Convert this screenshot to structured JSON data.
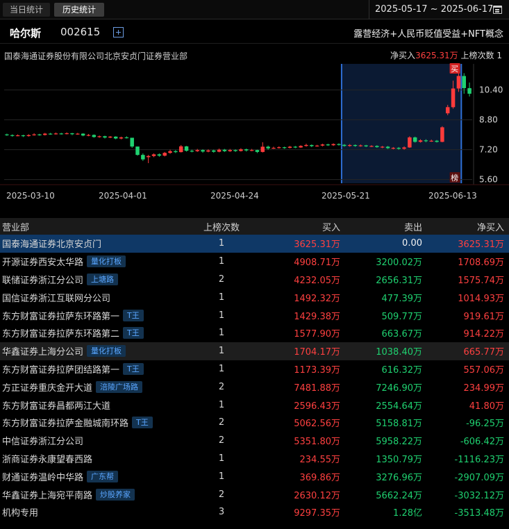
{
  "tabs": {
    "today": "当日统计",
    "history": "历史统计"
  },
  "date_range": "2025-05-17 ~ 2025-06-17",
  "stock": {
    "name": "哈尔斯",
    "code": "002615",
    "concepts": "露营经济+人民币贬值受益+NFT概念"
  },
  "chart_header": {
    "broker": "国泰海通证券股份有限公司北京安贞门证券营业部",
    "net_buy_label": "净买入",
    "net_buy_value": "3625.31万",
    "times_label": "上榜次数",
    "times_value": "1"
  },
  "chart_data": {
    "type": "candlestick",
    "y_ticks": [
      "10.40",
      "8.80",
      "7.20",
      "5.60"
    ],
    "y_tick_values": [
      10.4,
      8.8,
      7.2,
      5.6
    ],
    "ylim": [
      5.4,
      11.8
    ],
    "x_ticks": [
      "2025-03-10",
      "2025-04-01",
      "2025-04-24",
      "2025-05-21",
      "2025-06-13"
    ],
    "markers": {
      "buy": "买",
      "list": "榜"
    },
    "candles": [
      [
        8.02,
        7.98,
        8.06,
        7.94
      ],
      [
        7.98,
        7.95,
        8.02,
        7.9
      ],
      [
        7.95,
        7.97,
        8.02,
        7.92
      ],
      [
        7.97,
        7.93,
        8.0,
        7.88
      ],
      [
        7.93,
        7.98,
        8.03,
        7.9
      ],
      [
        7.98,
        8.02,
        8.08,
        7.95
      ],
      [
        8.02,
        7.99,
        8.05,
        7.95
      ],
      [
        7.99,
        8.06,
        8.1,
        7.96
      ],
      [
        8.06,
        8.04,
        8.1,
        8.0
      ],
      [
        8.04,
        8.07,
        8.12,
        8.01
      ],
      [
        8.07,
        8.05,
        8.1,
        8.01
      ],
      [
        8.05,
        8.08,
        8.13,
        8.02
      ],
      [
        8.08,
        8.03,
        8.1,
        7.98
      ],
      [
        8.03,
        8.06,
        8.1,
        8.0
      ],
      [
        8.06,
        7.96,
        8.08,
        7.92
      ],
      [
        7.96,
        7.99,
        8.04,
        7.92
      ],
      [
        7.99,
        7.88,
        8.02,
        7.84
      ],
      [
        7.88,
        7.92,
        7.96,
        7.84
      ],
      [
        7.92,
        7.85,
        7.95,
        7.8
      ],
      [
        7.85,
        7.9,
        7.93,
        7.82
      ],
      [
        7.9,
        7.8,
        7.92,
        7.76
      ],
      [
        7.8,
        7.86,
        7.9,
        7.76
      ],
      [
        7.86,
        7.84,
        7.92,
        7.8
      ],
      [
        7.84,
        7.37,
        7.5,
        7.3
      ],
      [
        7.37,
        6.92,
        7.2,
        6.88
      ],
      [
        6.92,
        6.68,
        7.0,
        6.6
      ],
      [
        6.8,
        6.86,
        6.92,
        6.48
      ],
      [
        6.86,
        6.95,
        7.0,
        6.8
      ],
      [
        6.95,
        6.88,
        7.0,
        6.82
      ],
      [
        6.88,
        7.03,
        7.08,
        6.84
      ],
      [
        7.03,
        7.12,
        7.2,
        6.98
      ],
      [
        7.12,
        7.07,
        7.18,
        7.02
      ],
      [
        7.07,
        7.38,
        7.45,
        7.05
      ],
      [
        7.38,
        7.14,
        7.4,
        7.1
      ],
      [
        7.14,
        7.12,
        7.2,
        7.06
      ],
      [
        7.12,
        7.18,
        7.24,
        7.08
      ],
      [
        7.18,
        7.1,
        7.22,
        7.04
      ],
      [
        7.1,
        7.16,
        7.22,
        7.06
      ],
      [
        7.16,
        7.09,
        7.2,
        7.04
      ],
      [
        7.09,
        7.2,
        7.26,
        7.06
      ],
      [
        7.2,
        7.12,
        7.24,
        7.08
      ],
      [
        7.12,
        7.18,
        7.24,
        7.08
      ],
      [
        7.18,
        7.13,
        7.22,
        7.08
      ],
      [
        7.13,
        7.22,
        7.28,
        7.1
      ],
      [
        7.22,
        7.16,
        7.26,
        7.1
      ],
      [
        7.16,
        7.18,
        7.24,
        7.12
      ],
      [
        7.18,
        7.08,
        7.2,
        7.02
      ],
      [
        7.08,
        7.36,
        7.6,
        7.05
      ],
      [
        7.36,
        7.27,
        7.42,
        7.2
      ],
      [
        7.27,
        7.3,
        7.36,
        7.24
      ],
      [
        7.3,
        7.33,
        7.38,
        7.26
      ],
      [
        7.33,
        7.3,
        7.36,
        7.25
      ],
      [
        7.3,
        7.36,
        7.4,
        7.27
      ],
      [
        7.36,
        7.32,
        7.4,
        7.28
      ],
      [
        7.32,
        7.4,
        7.44,
        7.3
      ],
      [
        7.4,
        7.45,
        7.52,
        7.36
      ],
      [
        7.45,
        7.39,
        7.48,
        7.34
      ],
      [
        7.39,
        7.42,
        7.46,
        7.36
      ],
      [
        7.42,
        7.48,
        7.52,
        7.38
      ],
      [
        7.48,
        7.44,
        7.52,
        7.4
      ],
      [
        7.44,
        7.5,
        7.54,
        7.4
      ],
      [
        7.5,
        7.46,
        7.54,
        7.42
      ],
      [
        7.46,
        7.4,
        7.5,
        7.36
      ],
      [
        7.4,
        7.45,
        7.5,
        7.36
      ],
      [
        7.45,
        7.4,
        7.48,
        7.36
      ],
      [
        7.4,
        7.43,
        7.48,
        7.36
      ],
      [
        7.43,
        7.38,
        7.46,
        7.34
      ],
      [
        7.38,
        7.4,
        7.44,
        7.34
      ],
      [
        7.4,
        7.34,
        7.44,
        7.3
      ],
      [
        7.34,
        7.36,
        7.4,
        7.28
      ],
      [
        7.36,
        7.28,
        7.4,
        7.24
      ],
      [
        7.28,
        7.3,
        7.34,
        7.22
      ],
      [
        7.3,
        7.25,
        7.34,
        7.2
      ],
      [
        7.25,
        7.32,
        7.38,
        7.2
      ],
      [
        7.32,
        7.86,
        7.92,
        7.3
      ],
      [
        7.86,
        7.62,
        7.9,
        7.58
      ],
      [
        7.62,
        7.7,
        7.76,
        7.58
      ],
      [
        7.7,
        7.66,
        7.76,
        7.6
      ],
      [
        7.66,
        7.68,
        7.74,
        7.62
      ],
      [
        7.68,
        7.62,
        7.72,
        7.58
      ],
      [
        7.62,
        8.4,
        8.46,
        7.6
      ],
      [
        9.15,
        9.48,
        9.6,
        9.05
      ],
      [
        9.48,
        10.48,
        10.9,
        9.4
      ],
      [
        10.48,
        11.15,
        11.4,
        10.3
      ],
      [
        11.15,
        10.5,
        11.3,
        10.2
      ],
      [
        10.5,
        10.2,
        10.8,
        10.05
      ]
    ],
    "listing_index": 82,
    "highlight_range": [
      62,
      83
    ]
  },
  "table": {
    "headers": {
      "name": "营业部",
      "count": "上榜次数",
      "buy": "买入",
      "sell": "卖出",
      "net": "净买入"
    },
    "rows": [
      {
        "name": "国泰海通证券北京安贞门",
        "tag": "",
        "count": "1",
        "buy": "3625.31万",
        "sell": "0.00",
        "net": "3625.31万",
        "net_color": "red",
        "sell_color": "white",
        "style": "selected"
      },
      {
        "name": "开源证券西安太华路",
        "tag": "量化打板",
        "count": "1",
        "buy": "4908.71万",
        "sell": "3200.02万",
        "net": "1708.69万",
        "net_color": "red",
        "sell_color": "green",
        "style": ""
      },
      {
        "name": "联储证券浙江分公司",
        "tag": "上塘路",
        "count": "2",
        "buy": "4232.05万",
        "sell": "2656.31万",
        "net": "1575.74万",
        "net_color": "red",
        "sell_color": "green",
        "style": ""
      },
      {
        "name": "国信证券浙江互联网分公司",
        "tag": "",
        "count": "1",
        "buy": "1492.32万",
        "sell": "477.39万",
        "net": "1014.93万",
        "net_color": "red",
        "sell_color": "green",
        "style": ""
      },
      {
        "name": "东方财富证券拉萨东环路第一",
        "tag": "T王",
        "count": "1",
        "buy": "1429.38万",
        "sell": "509.77万",
        "net": "919.61万",
        "net_color": "red",
        "sell_color": "green",
        "style": ""
      },
      {
        "name": "东方财富证券拉萨东环路第二",
        "tag": "T王",
        "count": "1",
        "buy": "1577.90万",
        "sell": "663.67万",
        "net": "914.22万",
        "net_color": "red",
        "sell_color": "green",
        "style": ""
      },
      {
        "name": "华鑫证券上海分公司",
        "tag": "量化打板",
        "count": "1",
        "buy": "1704.17万",
        "sell": "1038.40万",
        "net": "665.77万",
        "net_color": "red",
        "sell_color": "green",
        "style": "hl"
      },
      {
        "name": "东方财富证券拉萨团结路第一",
        "tag": "T王",
        "count": "1",
        "buy": "1173.39万",
        "sell": "616.32万",
        "net": "557.06万",
        "net_color": "red",
        "sell_color": "green",
        "style": ""
      },
      {
        "name": "方正证券重庆金开大道",
        "tag": "涪陵广场路",
        "count": "2",
        "buy": "7481.88万",
        "sell": "7246.90万",
        "net": "234.99万",
        "net_color": "red",
        "sell_color": "green",
        "style": ""
      },
      {
        "name": "东方财富证券昌都两江大道",
        "tag": "",
        "count": "1",
        "buy": "2596.43万",
        "sell": "2554.64万",
        "net": "41.80万",
        "net_color": "red",
        "sell_color": "green",
        "style": ""
      },
      {
        "name": "东方财富证券拉萨金融城南环路",
        "tag": "T王",
        "count": "2",
        "buy": "5062.56万",
        "sell": "5158.81万",
        "net": "-96.25万",
        "net_color": "green",
        "sell_color": "green",
        "style": ""
      },
      {
        "name": "中信证券浙江分公司",
        "tag": "",
        "count": "2",
        "buy": "5351.80万",
        "sell": "5958.22万",
        "net": "-606.42万",
        "net_color": "green",
        "sell_color": "green",
        "style": ""
      },
      {
        "name": "浙商证券永康望春西路",
        "tag": "",
        "count": "1",
        "buy": "234.55万",
        "sell": "1350.79万",
        "net": "-1116.23万",
        "net_color": "green",
        "sell_color": "green",
        "style": ""
      },
      {
        "name": "财通证券温岭中华路",
        "tag": "广东帮",
        "count": "1",
        "buy": "369.86万",
        "sell": "3276.96万",
        "net": "-2907.09万",
        "net_color": "green",
        "sell_color": "green",
        "style": ""
      },
      {
        "name": "华鑫证券上海宛平南路",
        "tag": "炒股养家",
        "count": "2",
        "buy": "2630.12万",
        "sell": "5662.24万",
        "net": "-3032.12万",
        "net_color": "green",
        "sell_color": "green",
        "style": ""
      },
      {
        "name": "机构专用",
        "tag": "",
        "count": "3",
        "buy": "9297.35万",
        "sell": "1.28亿",
        "net": "-3513.48万",
        "net_color": "green",
        "sell_color": "green",
        "style": ""
      }
    ]
  },
  "colors": {
    "up": "#ff3b3b",
    "down": "#1fd170",
    "accent": "#2e6fd6",
    "selected_row": "#0f3866",
    "tag_bg": "#13324f",
    "tag_text": "#5aa6ff"
  }
}
